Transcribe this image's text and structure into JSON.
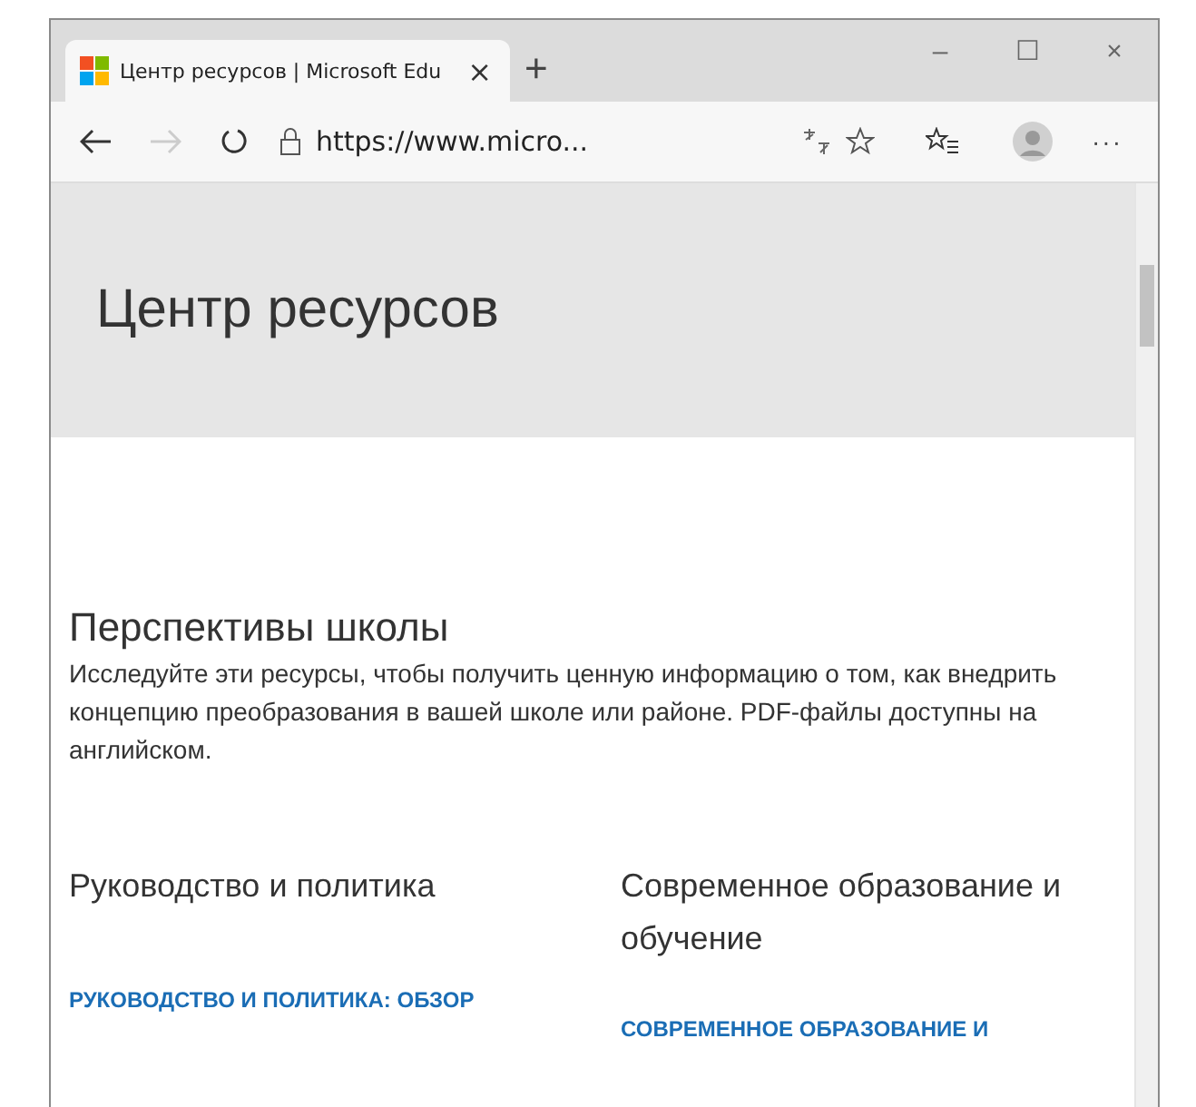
{
  "browser": {
    "tab": {
      "title": "Центр ресурсов | Microsoft Edu",
      "close": "×",
      "selected": true
    },
    "new_tab": "+",
    "address": "https://www.micro...",
    "controls": {
      "minimize": "–",
      "maximize": "☐",
      "close": "×"
    },
    "more": "···"
  },
  "page": {
    "header": "Центр ресурсов",
    "section": {
      "title": "Перспективы школы",
      "text": "Исследуйте эти ресурсы, чтобы получить ценную информацию о том, как внедрить концепцию преобразования в вашей школе или районе. PDF-файлы доступны на английском."
    },
    "columns": [
      {
        "title": "Руководство и политика",
        "link": "РУКОВОДСТВО И ПОЛИТИКА: ОБЗОР"
      },
      {
        "title": "Современное образование и обучение",
        "link": "СОВРЕМЕННОЕ ОБРАЗОВАНИЕ И"
      }
    ]
  }
}
